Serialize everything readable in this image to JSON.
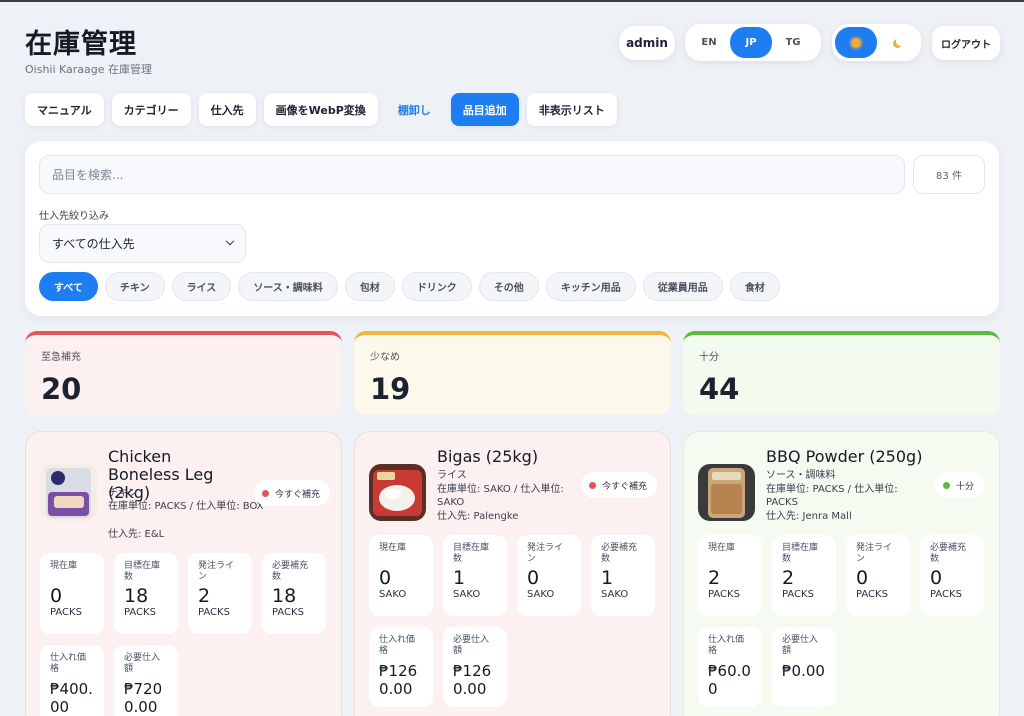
{
  "header": {
    "title": "在庫管理",
    "subtitle": "Oishii Karaage 在庫管理",
    "user": "admin",
    "languages": [
      "EN",
      "JP",
      "TG"
    ],
    "active_language": "JP",
    "logout_label": "ログアウト"
  },
  "toolbar": {
    "manual": "マニュアル",
    "category": "カテゴリー",
    "supplier": "仕入先",
    "webp": "画像をWebP変換",
    "stocktake": "棚卸し",
    "add_item": "品目追加",
    "hidden_list": "非表示リスト"
  },
  "search": {
    "placeholder": "品目を検索...",
    "count": "83 件",
    "supplier_filter_label": "仕入先絞り込み",
    "supplier_selected": "すべての仕入先"
  },
  "categories": [
    "すべて",
    "チキン",
    "ライス",
    "ソース・調味料",
    "包材",
    "ドリンク",
    "その他",
    "キッチン用品",
    "従業員用品",
    "食材"
  ],
  "stats": {
    "urgent": {
      "label": "至急補充",
      "value": "20",
      "color": "#e0565a"
    },
    "low": {
      "label": "少なめ",
      "value": "19",
      "color": "#f0b63a"
    },
    "enough": {
      "label": "十分",
      "value": "44",
      "color": "#5cba3c"
    }
  },
  "items": [
    {
      "name": "Chicken Boneless Leg (2kg)",
      "category": "チキン",
      "units": "在庫単位: PACKS / 仕入単位: BOX",
      "supplier": "仕入先: E&L",
      "status": "今すぐ補充",
      "current_label": "現在庫",
      "current": "0",
      "current_unit": "PACKS",
      "target_label": "目標在庫数",
      "target": "18",
      "target_unit": "PACKS",
      "reorder_label": "発注ライン",
      "reorder": "2",
      "reorder_unit": "PACKS",
      "need_label": "必要補充数",
      "need": "18",
      "need_unit": "PACKS",
      "price_label": "仕入れ価格",
      "price": "₱400.00",
      "cost_label": "必要仕入額",
      "cost": "₱7200.00"
    },
    {
      "name": "Bigas (25kg)",
      "category": "ライス",
      "units": "在庫単位: SAKO / 仕入単位: SAKO",
      "supplier": "仕入先: Palengke",
      "status": "今すぐ補充",
      "current_label": "現在庫",
      "current": "0",
      "current_unit": "SAKO",
      "target_label": "目標在庫数",
      "target": "1",
      "target_unit": "SAKO",
      "reorder_label": "発注ライン",
      "reorder": "0",
      "reorder_unit": "SAKO",
      "need_label": "必要補充数",
      "need": "1",
      "need_unit": "SAKO",
      "price_label": "仕入れ価格",
      "price": "₱1260.00",
      "cost_label": "必要仕入額",
      "cost": "₱1260.00"
    },
    {
      "name": "BBQ Powder (250g)",
      "category": "ソース・調味料",
      "units": "在庫単位: PACKS / 仕入単位: PACKS",
      "supplier": "仕入先: Jenra Mall",
      "status": "十分",
      "current_label": "現在庫",
      "current": "2",
      "current_unit": "PACKS",
      "target_label": "目標在庫数",
      "target": "2",
      "target_unit": "PACKS",
      "reorder_label": "発注ライン",
      "reorder": "0",
      "reorder_unit": "PACKS",
      "need_label": "必要補充数",
      "need": "0",
      "need_unit": "PACKS",
      "price_label": "仕入れ価格",
      "price": "₱60.00",
      "cost_label": "必要仕入額",
      "cost": "₱0.00"
    }
  ]
}
